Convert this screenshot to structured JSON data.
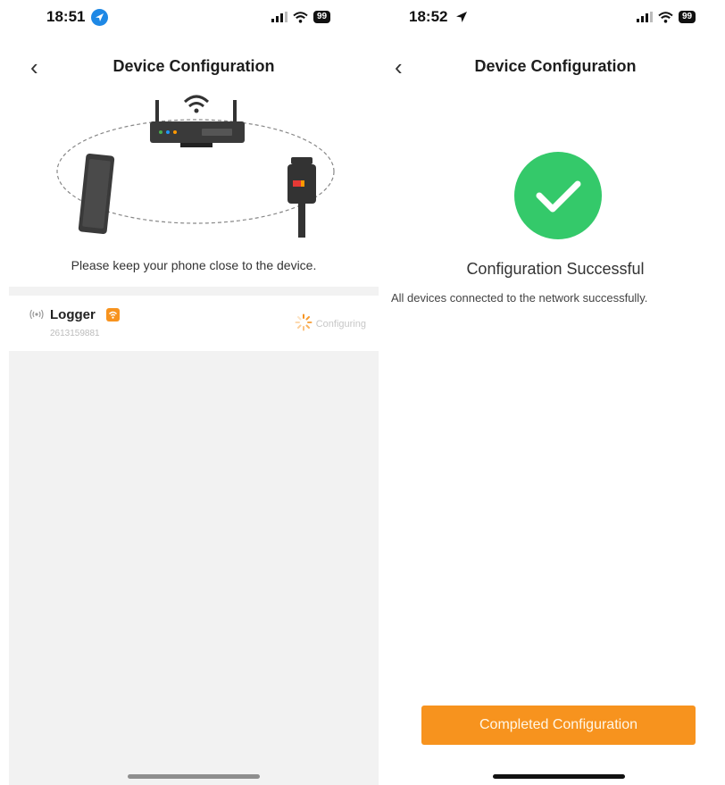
{
  "left_screen": {
    "status_bar": {
      "time": "18:51",
      "battery": "99"
    },
    "title": "Device Configuration",
    "hint": "Please keep your phone close to the device.",
    "device": {
      "name": "Logger",
      "serial": "2613159881",
      "status": "Configuring"
    }
  },
  "right_screen": {
    "status_bar": {
      "time": "18:52",
      "battery": "99"
    },
    "title": "Device Configuration",
    "success_title": "Configuration Successful",
    "success_message": "All devices connected to the network  successfully.",
    "button_label": "Completed Configuration"
  },
  "colors": {
    "accent": "#f7931e",
    "success": "#34c96a",
    "background_gray": "#f2f2f2"
  },
  "icons": [
    "location-arrow-icon",
    "cellular-signal-icon",
    "wifi-icon",
    "battery-icon",
    "back-chevron-icon",
    "router-icon",
    "smartphone-icon",
    "logger-device-icon",
    "antenna-icon",
    "loading-spinner-icon",
    "checkmark-icon"
  ]
}
